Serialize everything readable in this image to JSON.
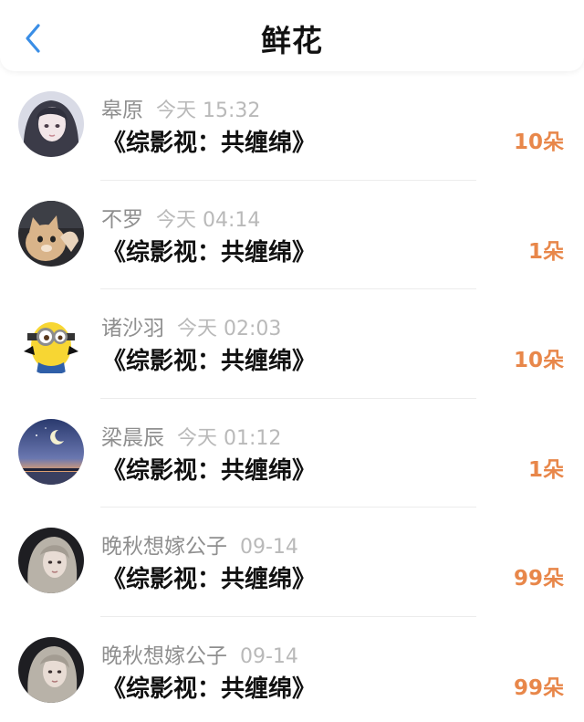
{
  "header": {
    "title": "鲜花",
    "back_icon": "chevron-left-icon",
    "back_color": "#3a8ee6"
  },
  "colors": {
    "count": "#e8874a",
    "name": "#8f8f8f",
    "time": "#b9b9b9"
  },
  "records": [
    {
      "user": "皋原",
      "time": "今天 15:32",
      "book": "《综影视：共缠绵》",
      "count": "10朵",
      "avatar": "avatar-girl-dark-hair"
    },
    {
      "user": "不罗",
      "time": "今天 04:14",
      "book": "《综影视：共缠绵》",
      "count": "1朵",
      "avatar": "avatar-cat"
    },
    {
      "user": "诸沙羽",
      "time": "今天 02:03",
      "book": "《综影视：共缠绵》",
      "count": "10朵",
      "avatar": "avatar-minion"
    },
    {
      "user": "梁晨辰",
      "time": "今天 01:12",
      "book": "《综影视：共缠绵》",
      "count": "1朵",
      "avatar": "avatar-night-sky"
    },
    {
      "user": "晚秋想嫁公子",
      "time": "09-14",
      "book": "《综影视：共缠绵》",
      "count": "99朵",
      "avatar": "avatar-girl-light-hair"
    },
    {
      "user": "晚秋想嫁公子",
      "time": "09-14",
      "book": "《综影视：共缠绵》",
      "count": "99朵",
      "avatar": "avatar-girl-light-hair"
    }
  ]
}
